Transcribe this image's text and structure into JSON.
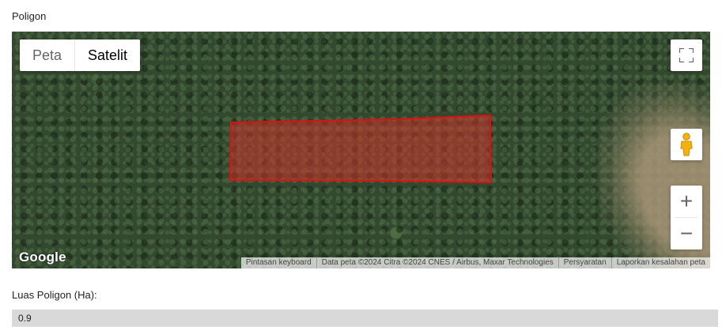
{
  "polygon_section": {
    "label": "Poligon"
  },
  "map": {
    "map_type": {
      "map_label": "Peta",
      "satellite_label": "Satelit",
      "selected": "Satelit"
    },
    "controls": {
      "fullscreen_icon": "fullscreen-icon",
      "street_view_icon": "pegman-icon",
      "zoom_in": "+",
      "zoom_out": "−"
    },
    "logo": "Google",
    "attribution": {
      "shortcuts": "Pintasan keyboard",
      "data": "Data peta ©2024 Citra ©2024 CNES / Airbus, Maxar Technologies",
      "terms": "Persyaratan",
      "report": "Laporkan kesalahan peta"
    },
    "polygon": {
      "fill_color": "#d0342c",
      "stroke_color": "#e01010"
    }
  },
  "area": {
    "label": "Luas Poligon (Ha):",
    "value": "0.9"
  }
}
